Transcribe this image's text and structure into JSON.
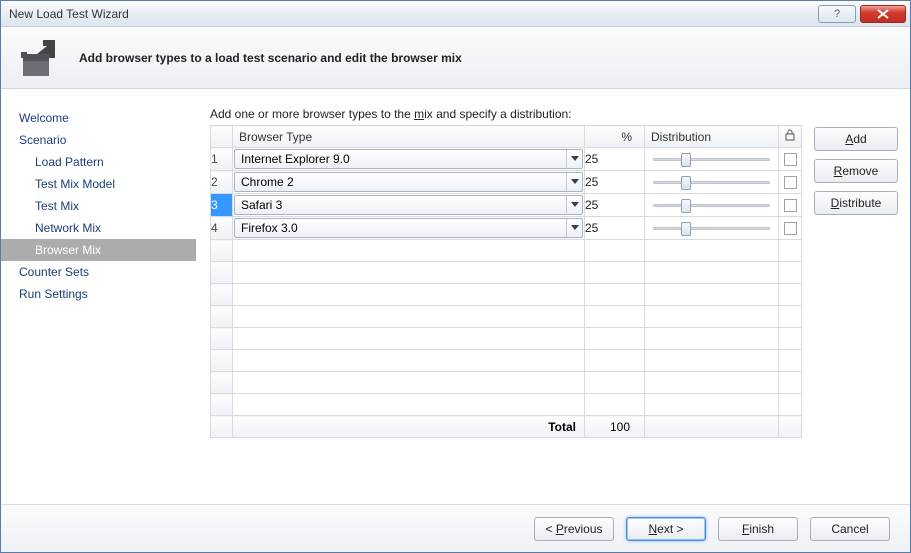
{
  "window": {
    "title": "New Load Test Wizard"
  },
  "header": {
    "text": "Add browser types to a load test scenario and edit the browser mix"
  },
  "nav": {
    "items": [
      {
        "label": "Welcome",
        "sub": false,
        "selected": false
      },
      {
        "label": "Scenario",
        "sub": false,
        "selected": false
      },
      {
        "label": "Load Pattern",
        "sub": true,
        "selected": false
      },
      {
        "label": "Test Mix Model",
        "sub": true,
        "selected": false
      },
      {
        "label": "Test Mix",
        "sub": true,
        "selected": false
      },
      {
        "label": "Network Mix",
        "sub": true,
        "selected": false
      },
      {
        "label": "Browser Mix",
        "sub": true,
        "selected": true
      },
      {
        "label": "Counter Sets",
        "sub": false,
        "selected": false
      },
      {
        "label": "Run Settings",
        "sub": false,
        "selected": false
      }
    ]
  },
  "instruction": {
    "prefix": "Add one or more browser types to the ",
    "hot": "m",
    "suffix": "ix and specify a distribution:"
  },
  "columns": {
    "browser": "Browser Type",
    "pct": "%",
    "dist": "Distribution"
  },
  "rows": [
    {
      "idx": "1",
      "browser": "Internet Explorer 9.0",
      "pct": "25",
      "slider": 25,
      "selected": false
    },
    {
      "idx": "2",
      "browser": "Chrome 2",
      "pct": "25",
      "slider": 25,
      "selected": false
    },
    {
      "idx": "3",
      "browser": "Safari 3",
      "pct": "25",
      "slider": 25,
      "selected": true
    },
    {
      "idx": "4",
      "browser": "Firefox 3.0",
      "pct": "25",
      "slider": 25,
      "selected": false
    }
  ],
  "empty_rows": 8,
  "total": {
    "label": "Total",
    "pct": "100"
  },
  "side": {
    "add": {
      "pre": "",
      "hot": "A",
      "post": "dd"
    },
    "remove": {
      "pre": "",
      "hot": "R",
      "post": "emove"
    },
    "distribute": {
      "pre": "",
      "hot": "D",
      "post": "istribute"
    }
  },
  "footer": {
    "prev": {
      "pre": "< ",
      "hot": "P",
      "post": "revious"
    },
    "next": {
      "pre": "",
      "hot": "N",
      "post": "ext >"
    },
    "finish": {
      "pre": "",
      "hot": "F",
      "post": "inish"
    },
    "cancel": "Cancel"
  }
}
